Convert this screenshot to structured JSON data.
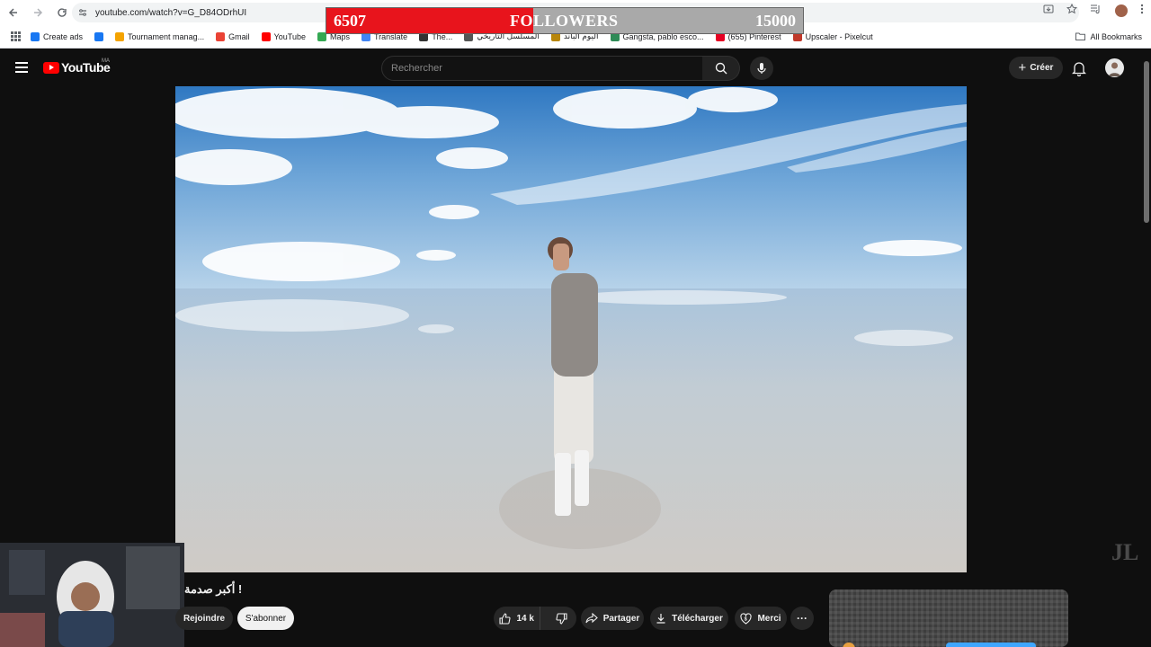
{
  "browser": {
    "url": "youtube.com/watch?v=G_D84ODrhUI",
    "bookmarks": [
      {
        "label": "Create ads",
        "color": "#1877f2"
      },
      {
        "label": "",
        "color": "#1877f2"
      },
      {
        "label": "Tournament manag...",
        "color": "#f4a300"
      },
      {
        "label": "Gmail",
        "color": "#ea4335"
      },
      {
        "label": "YouTube",
        "color": "#ff0000"
      },
      {
        "label": "Maps",
        "color": "#34a853"
      },
      {
        "label": "Translate",
        "color": "#4285f4"
      },
      {
        "label": "The...",
        "color": "#333333"
      },
      {
        "label": "ﺍﻟﻤﺴﻠﺴﻞ ﺍﻟﺘﺎﺭﻳﺨﻲ",
        "color": "#555555"
      },
      {
        "label": "ﺍﻟﻴﻮﻡ ﺍﻟﺒﺎﻧﺪ",
        "color": "#b8860b"
      },
      {
        "label": "Gangsta, pablo esco...",
        "color": "#2e8b57"
      },
      {
        "label": "(655) Pinterest",
        "color": "#e60023"
      },
      {
        "label": "Upscaler - Pixelcut",
        "color": "#c0392b"
      }
    ],
    "all_bookmarks": "All Bookmarks"
  },
  "followers": {
    "count": "6507",
    "label": "FOLLOWERS",
    "goal": "15000",
    "progress": 0.4338,
    "fill_color": "#e8141c"
  },
  "youtube": {
    "logo_text": "YouTube",
    "country_code": "MA",
    "search_placeholder": "Rechercher",
    "create_label": "Créer",
    "video_title": "! أكبر صدمة",
    "join_label": "Rejoindre",
    "subscribe_label": "S'abonner",
    "likes": "14 k",
    "share_label": "Partager",
    "download_label": "Télécharger",
    "thanks_label": "Merci",
    "more_label": "···"
  }
}
